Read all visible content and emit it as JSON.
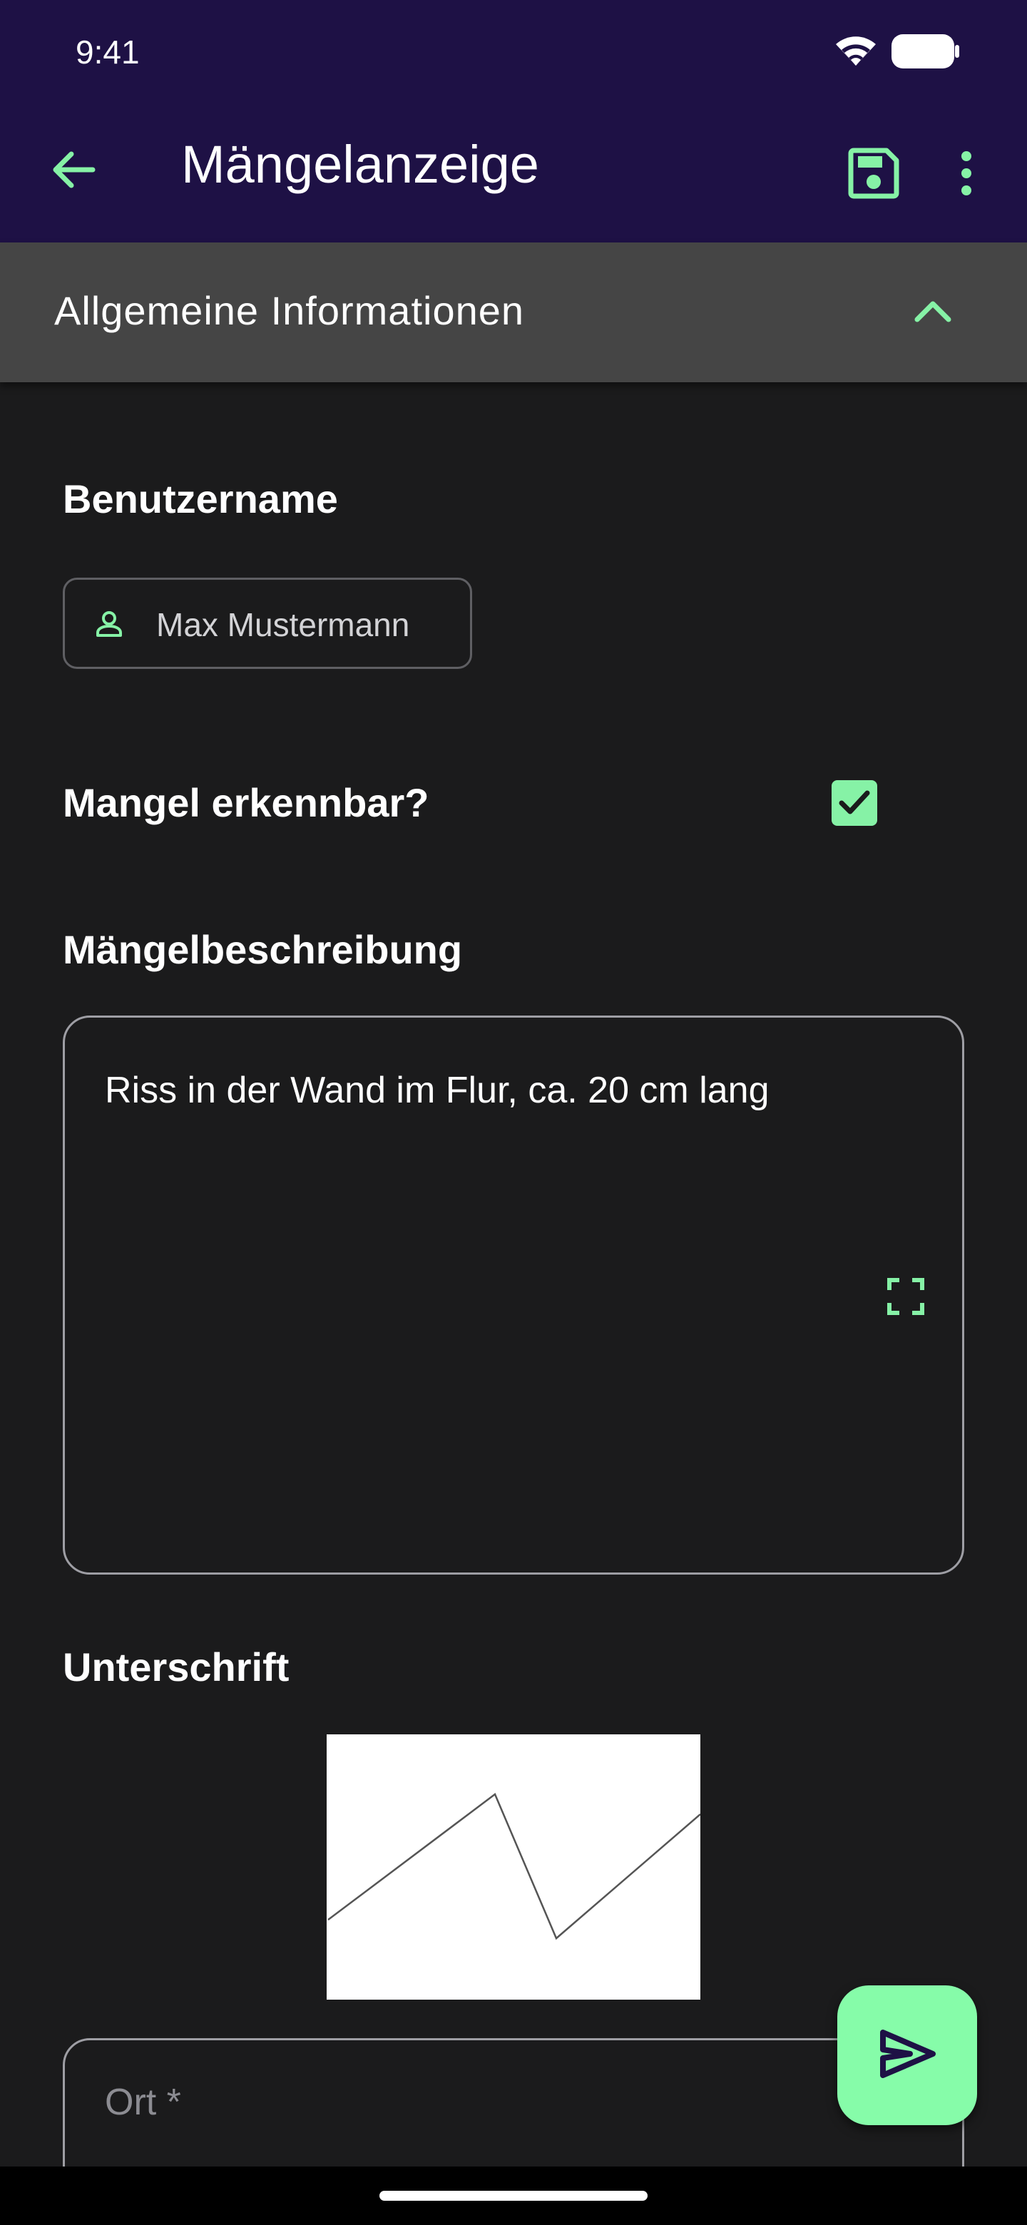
{
  "status_bar": {
    "time": "9:41"
  },
  "app_bar": {
    "title": "Mängelanzeige",
    "icons": {
      "back": "arrow-left-icon",
      "save": "floppy-disk-icon",
      "more": "more-vertical-icon"
    }
  },
  "section": {
    "title": "Allgemeine Informationen",
    "expanded": true
  },
  "form": {
    "username": {
      "label": "Benutzername",
      "value": "Max Mustermann",
      "icon": "person-icon"
    },
    "defect_visible": {
      "label": "Mangel erkennbar?",
      "checked": true
    },
    "description": {
      "label": "Mängelbeschreibung",
      "value": "Riss in der Wand im Flur, ca. 20 cm lang",
      "icon": "fullscreen-icon"
    },
    "signature": {
      "label": "Unterschrift"
    },
    "location": {
      "placeholder": "Ort *",
      "value": ""
    }
  },
  "fab": {
    "icon": "send-icon"
  },
  "colors": {
    "app_bar": "#1e1145",
    "accent": "#86f2a6",
    "background": "#1b1b1c",
    "section_header": "#454545"
  }
}
